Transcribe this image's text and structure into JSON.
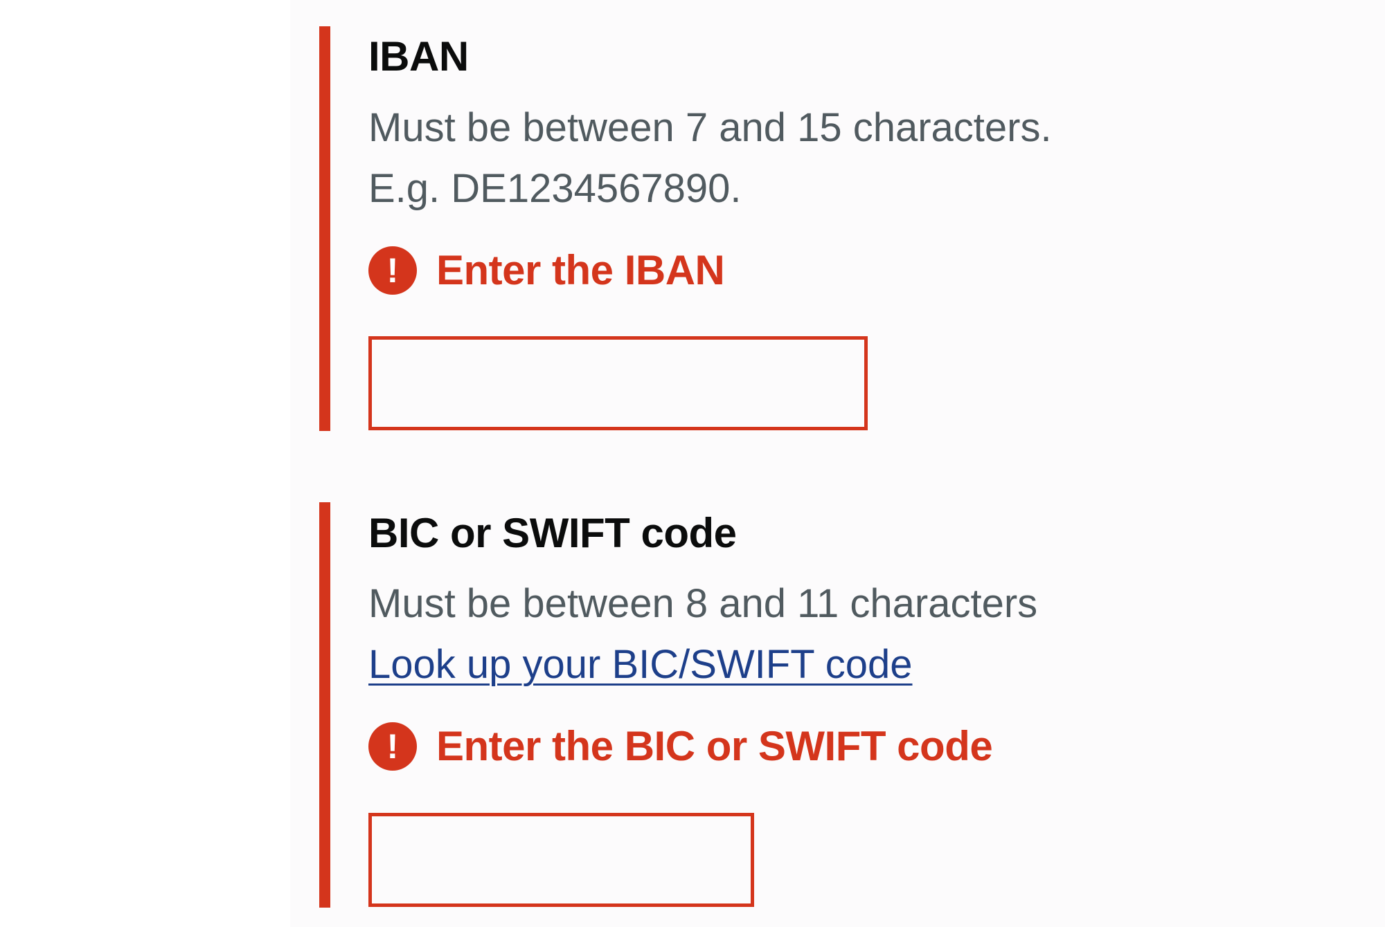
{
  "iban": {
    "label": "IBAN",
    "hint_line1": "Must be between 7 and 15 characters.",
    "hint_line2": "E.g. DE1234567890.",
    "error_icon": "!",
    "error_message": "Enter the IBAN",
    "value": ""
  },
  "bic": {
    "label": "BIC or SWIFT code",
    "hint": "Must be between 8 and 11 characters",
    "lookup_link": "Look up your BIC/SWIFT code",
    "error_icon": "!",
    "error_message": "Enter the BIC or SWIFT code",
    "value": ""
  },
  "colors": {
    "error": "#d4351c",
    "text": "#0b0c0c",
    "hint": "#505a5f",
    "link": "#1d3f8a",
    "background": "#fcfbfc"
  },
  "icons": {
    "error_icon": "exclamation-circle-icon"
  }
}
